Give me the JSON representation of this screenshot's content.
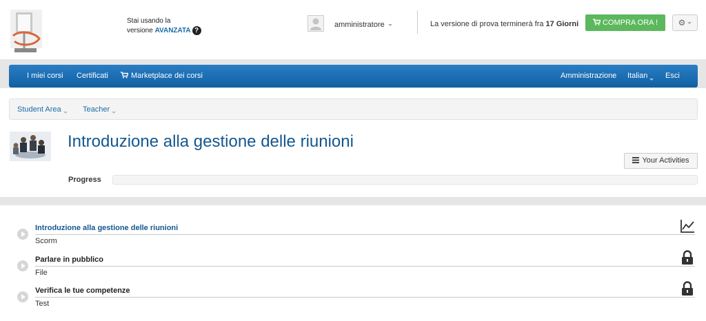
{
  "header": {
    "version_line1": "Stai usando la",
    "version_prefix": "versione ",
    "version_name": "AVANZATA",
    "help_glyph": "?",
    "username": "amministratore",
    "trial_text": "La versione di prova terminerà fra ",
    "trial_days": "17 Giorni",
    "buy_label": "COMPRA ORA !",
    "buy_color": "#5cb85c"
  },
  "nav": {
    "my_courses": "I miei corsi",
    "certificates": "Certificati",
    "marketplace": "Marketplace dei corsi",
    "admin": "Amministrazione",
    "language": "Italian",
    "logout": "Esci",
    "bar_color": "#1a6eb3"
  },
  "subnav": {
    "student_area": "Student Area",
    "teacher": "Teacher"
  },
  "course": {
    "title": "Introduzione alla gestione delle riunioni",
    "activities_button": "Your Activities",
    "progress_label": "Progress",
    "progress_value": 0
  },
  "activities": [
    {
      "title": "Introduzione alla gestione delle riunioni",
      "type": "Scorm",
      "status_icon": "chart-icon"
    },
    {
      "title": "Parlare in pubblico",
      "type": "File",
      "status_icon": "lock-icon"
    },
    {
      "title": "Verifica le tue competenze",
      "type": "Test",
      "status_icon": "lock-icon"
    }
  ]
}
